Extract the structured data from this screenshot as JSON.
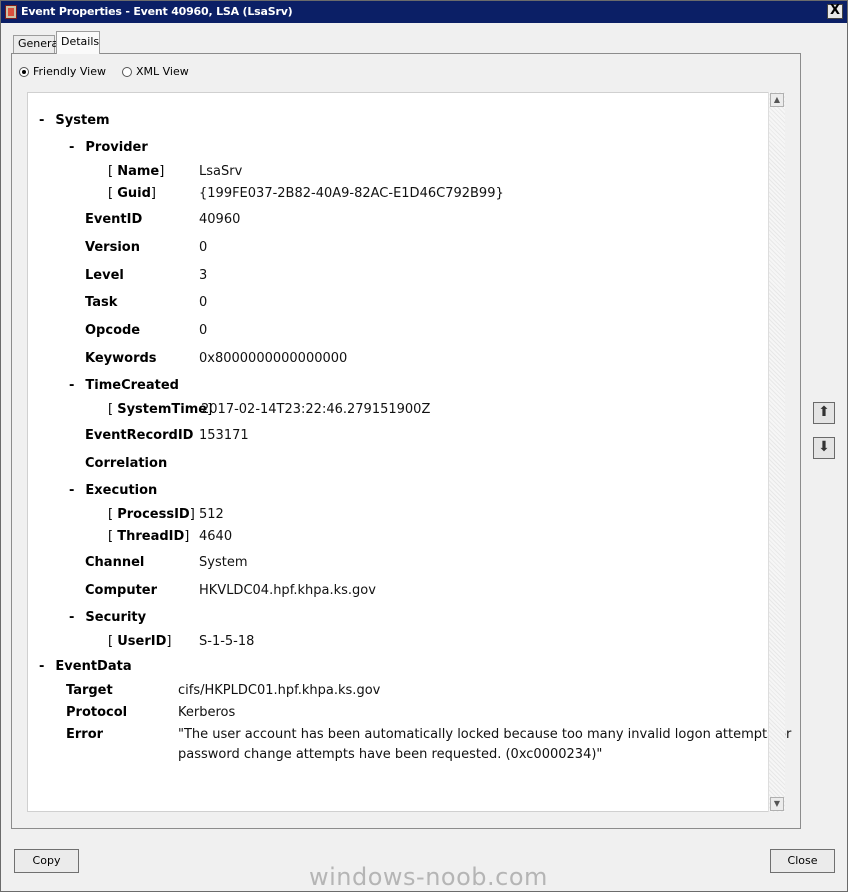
{
  "window": {
    "title": "Event Properties - Event 40960, LSA (LsaSrv)",
    "close_glyph": "X"
  },
  "tabs": [
    {
      "label": "General"
    },
    {
      "label": "Details"
    }
  ],
  "views": {
    "friendly_label": "Friendly View",
    "xml_label": "XML View",
    "selected": "Friendly View"
  },
  "tree": {
    "collapse_glyph": "-",
    "system": {
      "label": "System",
      "provider": {
        "label": "Provider",
        "name_key": "Name",
        "name_value": "LsaSrv",
        "guid_key": "Guid",
        "guid_value": "{199FE037-2B82-40A9-82AC-E1D46C792B99}"
      },
      "fields": [
        {
          "key": "EventID",
          "value": "40960"
        },
        {
          "key": "Version",
          "value": "0"
        },
        {
          "key": "Level",
          "value": "3"
        },
        {
          "key": "Task",
          "value": "0"
        },
        {
          "key": "Opcode",
          "value": "0"
        },
        {
          "key": "Keywords",
          "value": "0x8000000000000000"
        }
      ],
      "time_created": {
        "label": "TimeCreated",
        "system_time_key": "SystemTime",
        "system_time_value": "2017-02-14T23:22:46.279151900Z"
      },
      "event_record_id": {
        "key": "EventRecordID",
        "value": "153171"
      },
      "correlation": {
        "key": "Correlation",
        "value": ""
      },
      "execution": {
        "label": "Execution",
        "process_id_key": "ProcessID",
        "process_id_value": "512",
        "thread_id_key": "ThreadID",
        "thread_id_value": "4640"
      },
      "channel": {
        "key": "Channel",
        "value": "System"
      },
      "computer": {
        "key": "Computer",
        "value": "HKVLDC04.hpf.khpa.ks.gov"
      },
      "security": {
        "label": "Security",
        "user_id_key": "UserID",
        "user_id_value": "S-1-5-18"
      }
    },
    "event_data": {
      "label": "EventData",
      "target": {
        "key": "Target",
        "value": "cifs/HKPLDC01.hpf.khpa.ks.gov"
      },
      "protocol": {
        "key": "Protocol",
        "value": "Kerberos"
      },
      "error": {
        "key": "Error",
        "line1": "\"The user account has been automatically locked because too many invalid logon attempts or",
        "line2": "password change attempts have been requested. (0xc0000234)\""
      }
    }
  },
  "buttons": {
    "copy": "Copy",
    "close": "Close"
  },
  "watermark": "windows-noob.com",
  "icons": {
    "scroll_up": "▲",
    "scroll_down": "▼",
    "prev_event": "⬆",
    "next_event": "⬇"
  }
}
